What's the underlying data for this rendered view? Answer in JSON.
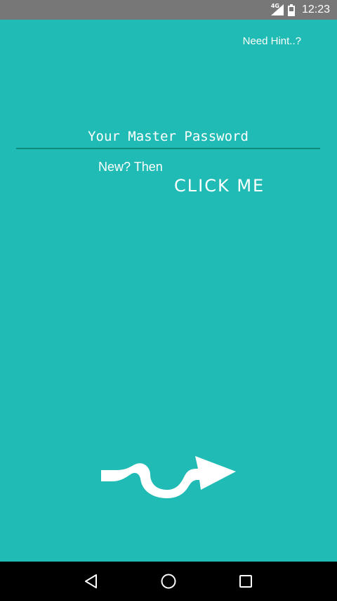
{
  "status_bar": {
    "network": "4G",
    "time": "12:23"
  },
  "main": {
    "hint_label": "Need Hint..?",
    "password_placeholder": "Your Master Password",
    "password_value": "",
    "new_prompt": "New? Then",
    "click_me_label": "CLICK ME",
    "submit_icon": "wavy-arrow-icon"
  },
  "nav_bar": {
    "back_icon": "back-triangle-icon",
    "home_icon": "home-circle-icon",
    "recents_icon": "recents-square-icon"
  },
  "colors": {
    "background": "#20BBB5",
    "status_bar": "#777777",
    "underline": "#0f8c78",
    "text": "#ffffff",
    "nav_bar": "#000000"
  }
}
